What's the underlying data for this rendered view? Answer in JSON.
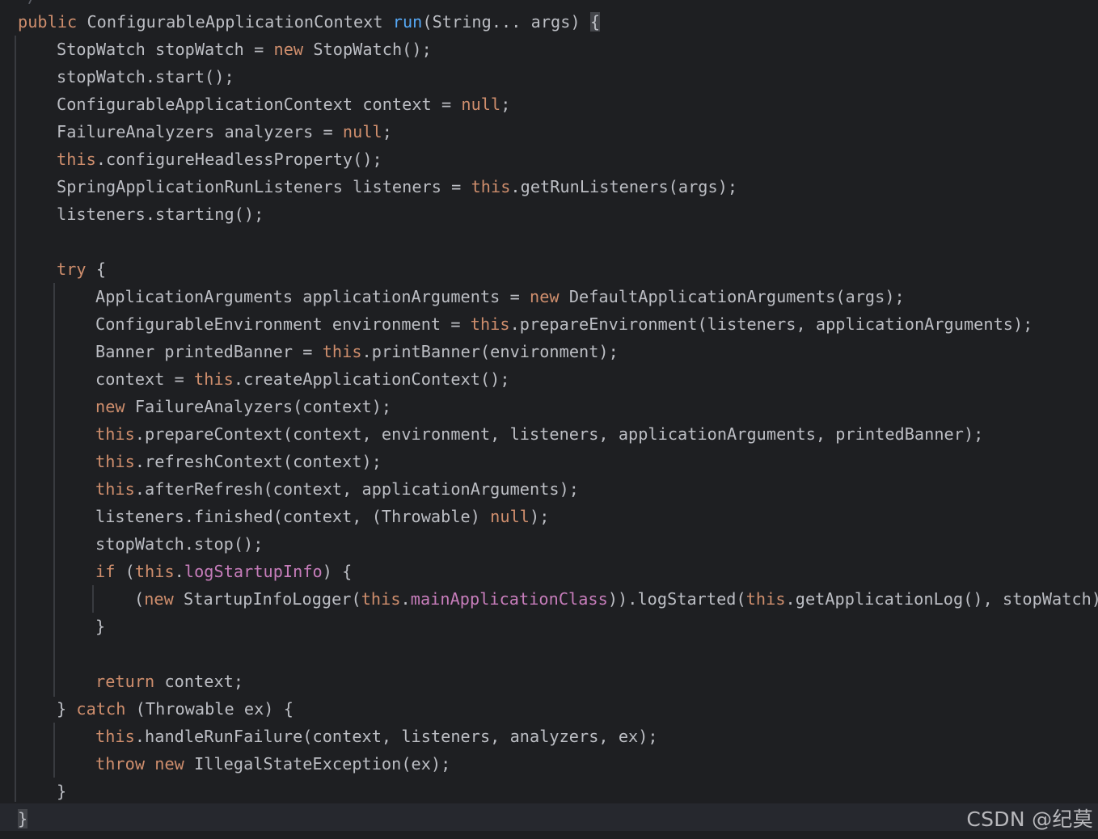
{
  "editor": {
    "fade_line": "*/",
    "lines": [
      [
        {
          "t": "public ",
          "c": "kw"
        },
        {
          "t": "ConfigurableApplicationContext "
        },
        {
          "t": "run",
          "c": "fn"
        },
        {
          "t": "(String... args) "
        },
        {
          "t": "{",
          "c": "brace-hl"
        }
      ],
      [
        {
          "t": "StopWatch stopWatch = "
        },
        {
          "t": "new ",
          "c": "kw"
        },
        {
          "t": "StopWatch();"
        }
      ],
      [
        {
          "t": "stopWatch.start();"
        }
      ],
      [
        {
          "t": "ConfigurableApplicationContext context = "
        },
        {
          "t": "null",
          "c": "kw"
        },
        {
          "t": ";"
        }
      ],
      [
        {
          "t": "FailureAnalyzers analyzers = "
        },
        {
          "t": "null",
          "c": "kw"
        },
        {
          "t": ";"
        }
      ],
      [
        {
          "t": "this",
          "c": "kw"
        },
        {
          "t": ".configureHeadlessProperty();"
        }
      ],
      [
        {
          "t": "SpringApplicationRunListeners listeners = "
        },
        {
          "t": "this",
          "c": "kw"
        },
        {
          "t": ".getRunListeners(args);"
        }
      ],
      [
        {
          "t": "listeners.starting();"
        }
      ],
      [],
      [
        {
          "t": "try ",
          "c": "kw"
        },
        {
          "t": "{"
        }
      ],
      [
        {
          "t": "ApplicationArguments applicationArguments = "
        },
        {
          "t": "new ",
          "c": "kw"
        },
        {
          "t": "DefaultApplicationArguments(args);"
        }
      ],
      [
        {
          "t": "ConfigurableEnvironment environment = "
        },
        {
          "t": "this",
          "c": "kw"
        },
        {
          "t": ".prepareEnvironment(listeners, applicationArguments);"
        }
      ],
      [
        {
          "t": "Banner printedBanner = "
        },
        {
          "t": "this",
          "c": "kw"
        },
        {
          "t": ".printBanner(environment);"
        }
      ],
      [
        {
          "t": "context = "
        },
        {
          "t": "this",
          "c": "kw"
        },
        {
          "t": ".createApplicationContext();"
        }
      ],
      [
        {
          "t": "new ",
          "c": "kw"
        },
        {
          "t": "FailureAnalyzers(context);"
        }
      ],
      [
        {
          "t": "this",
          "c": "kw"
        },
        {
          "t": ".prepareContext(context, environment, listeners, applicationArguments, printedBanner);"
        }
      ],
      [
        {
          "t": "this",
          "c": "kw"
        },
        {
          "t": ".refreshContext(context);"
        }
      ],
      [
        {
          "t": "this",
          "c": "kw"
        },
        {
          "t": ".afterRefresh(context, applicationArguments);"
        }
      ],
      [
        {
          "t": "listeners.finished(context, (Throwable) "
        },
        {
          "t": "null",
          "c": "kw"
        },
        {
          "t": ");"
        }
      ],
      [
        {
          "t": "stopWatch.stop();"
        }
      ],
      [
        {
          "t": "if ",
          "c": "kw"
        },
        {
          "t": "("
        },
        {
          "t": "this",
          "c": "kw"
        },
        {
          "t": "."
        },
        {
          "t": "logStartupInfo",
          "c": "fld"
        },
        {
          "t": ") {"
        }
      ],
      [
        {
          "t": "("
        },
        {
          "t": "new ",
          "c": "kw"
        },
        {
          "t": "StartupInfoLogger("
        },
        {
          "t": "this",
          "c": "kw"
        },
        {
          "t": "."
        },
        {
          "t": "mainApplicationClass",
          "c": "fld"
        },
        {
          "t": ")).logStarted("
        },
        {
          "t": "this",
          "c": "kw"
        },
        {
          "t": ".getApplicationLog(), stopWatch);"
        }
      ],
      [
        {
          "t": "}"
        }
      ],
      [],
      [
        {
          "t": "return ",
          "c": "kw"
        },
        {
          "t": "context;"
        }
      ],
      [
        {
          "t": "} "
        },
        {
          "t": "catch ",
          "c": "kw"
        },
        {
          "t": "(Throwable ex) {"
        }
      ],
      [
        {
          "t": "this",
          "c": "kw"
        },
        {
          "t": ".handleRunFailure(context, listeners, analyzers, ex);"
        }
      ],
      [
        {
          "t": "throw ",
          "c": "kw"
        },
        {
          "t": "new ",
          "c": "kw"
        },
        {
          "t": "IllegalStateException(ex);"
        }
      ],
      [
        {
          "t": "}"
        }
      ],
      [
        {
          "t": "}",
          "c": "brace-hl"
        }
      ]
    ]
  },
  "watermark": "CSDN @纪莫"
}
